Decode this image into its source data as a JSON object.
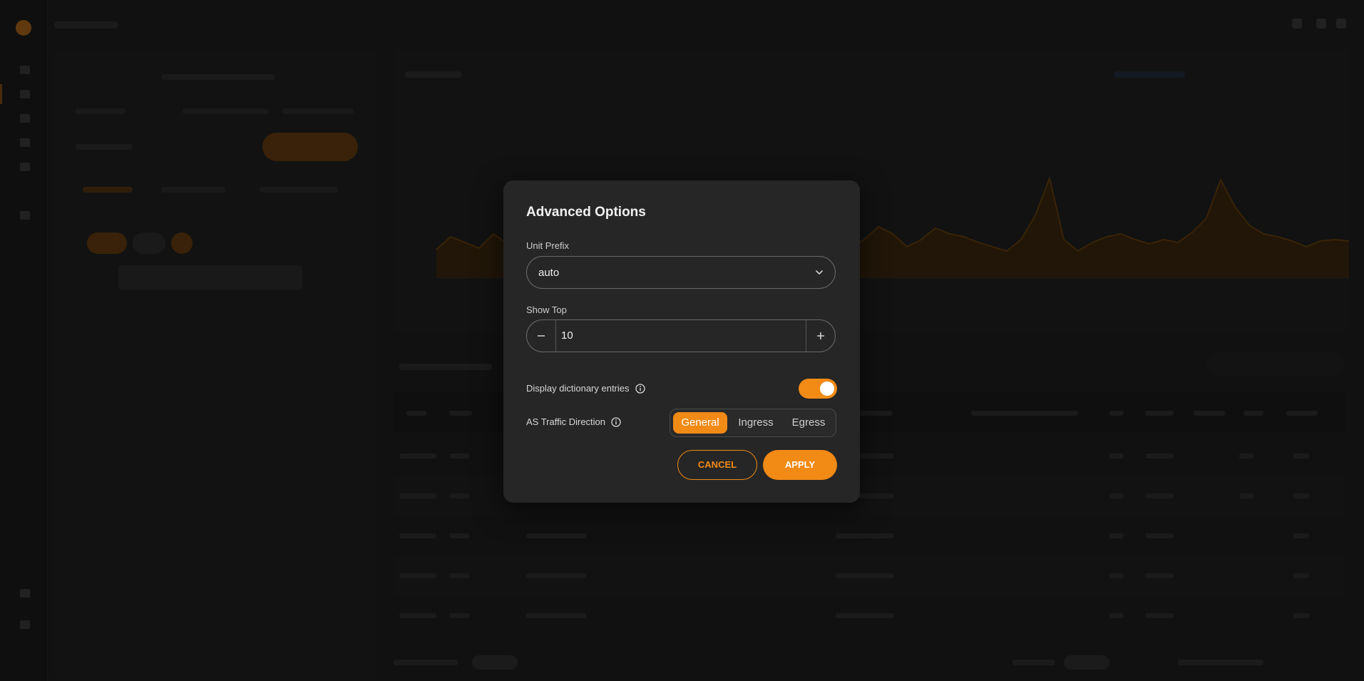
{
  "colors": {
    "accent": "#f28a16",
    "modal_bg": "#262626",
    "page_bg": "#1a1a1a"
  },
  "icons": {
    "unit_prefix_chevron": "chevron-down-icon",
    "stepper_decrement": "minus-icon",
    "stepper_increment": "plus-icon",
    "dictionary_info": "info-icon",
    "direction_info": "info-icon"
  },
  "modal": {
    "title": "Advanced Options",
    "unit_prefix": {
      "label": "Unit Prefix",
      "value": "auto"
    },
    "show_top": {
      "label": "Show Top",
      "value": "10"
    },
    "display_dictionary_entries": {
      "label": "Display dictionary entries",
      "enabled": true
    },
    "as_traffic_direction": {
      "label": "AS Traffic Direction",
      "options": [
        "General",
        "Ingress",
        "Egress"
      ],
      "selected": "General"
    },
    "cancel_label": "CANCEL",
    "apply_label": "APPLY"
  }
}
